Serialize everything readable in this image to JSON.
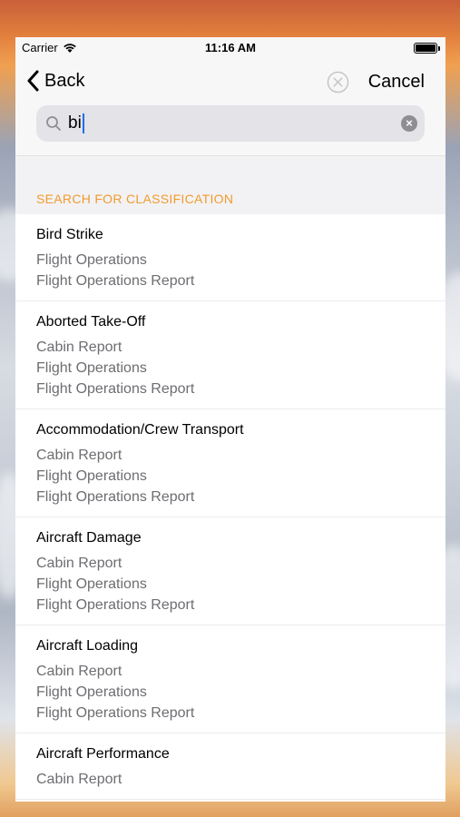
{
  "status_bar": {
    "carrier": "Carrier",
    "time": "11:16 AM"
  },
  "nav": {
    "back_label": "Back",
    "cancel_label": "Cancel"
  },
  "search": {
    "value": "bi"
  },
  "section_header": "SEARCH FOR CLASSIFICATION",
  "accent_color": "#f29a2e",
  "results": [
    {
      "title": "Bird Strike",
      "categories": [
        "Flight Operations",
        "Flight Operations Report"
      ]
    },
    {
      "title": "Aborted Take-Off",
      "categories": [
        "Cabin Report",
        "Flight Operations",
        "Flight Operations Report"
      ]
    },
    {
      "title": "Accommodation/Crew Transport",
      "categories": [
        "Cabin Report",
        "Flight Operations",
        "Flight Operations Report"
      ]
    },
    {
      "title": "Aircraft Damage",
      "categories": [
        "Cabin Report",
        "Flight Operations",
        "Flight Operations Report"
      ]
    },
    {
      "title": "Aircraft Loading",
      "categories": [
        "Cabin Report",
        "Flight Operations",
        "Flight Operations Report"
      ]
    },
    {
      "title": "Aircraft Performance",
      "categories": [
        "Cabin Report"
      ]
    }
  ]
}
